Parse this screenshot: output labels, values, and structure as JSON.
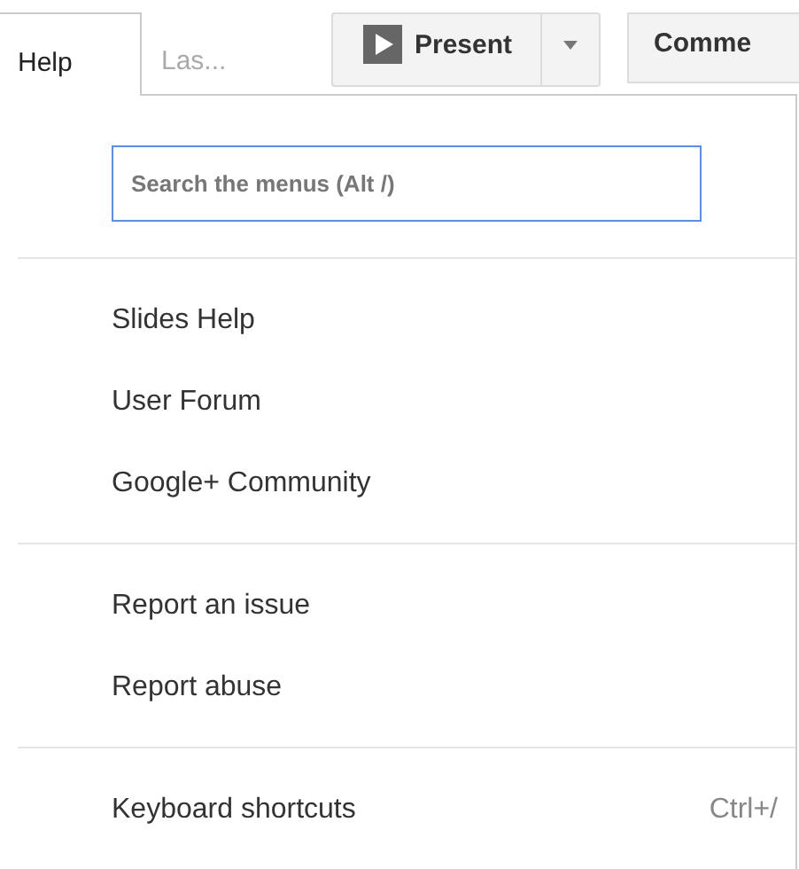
{
  "menu_bar": [
    {
      "label": "Help",
      "selected": true
    },
    {
      "label": "Las...",
      "selected": false
    }
  ],
  "toolbar": {
    "present": "Present",
    "comments": "Comme"
  },
  "menu": {
    "search": {
      "placeholder": "Search the menus (Alt /)"
    },
    "sections": [
      {
        "items": [
          {
            "label": "Slides Help"
          },
          {
            "label": "User Forum"
          },
          {
            "label": "Google+ Community"
          }
        ]
      },
      {
        "items": [
          {
            "label": "Report an issue"
          },
          {
            "label": "Report abuse"
          }
        ]
      },
      {
        "items": [
          {
            "label": "Keyboard shortcuts",
            "shortcut": "Ctrl+/"
          }
        ]
      }
    ]
  }
}
